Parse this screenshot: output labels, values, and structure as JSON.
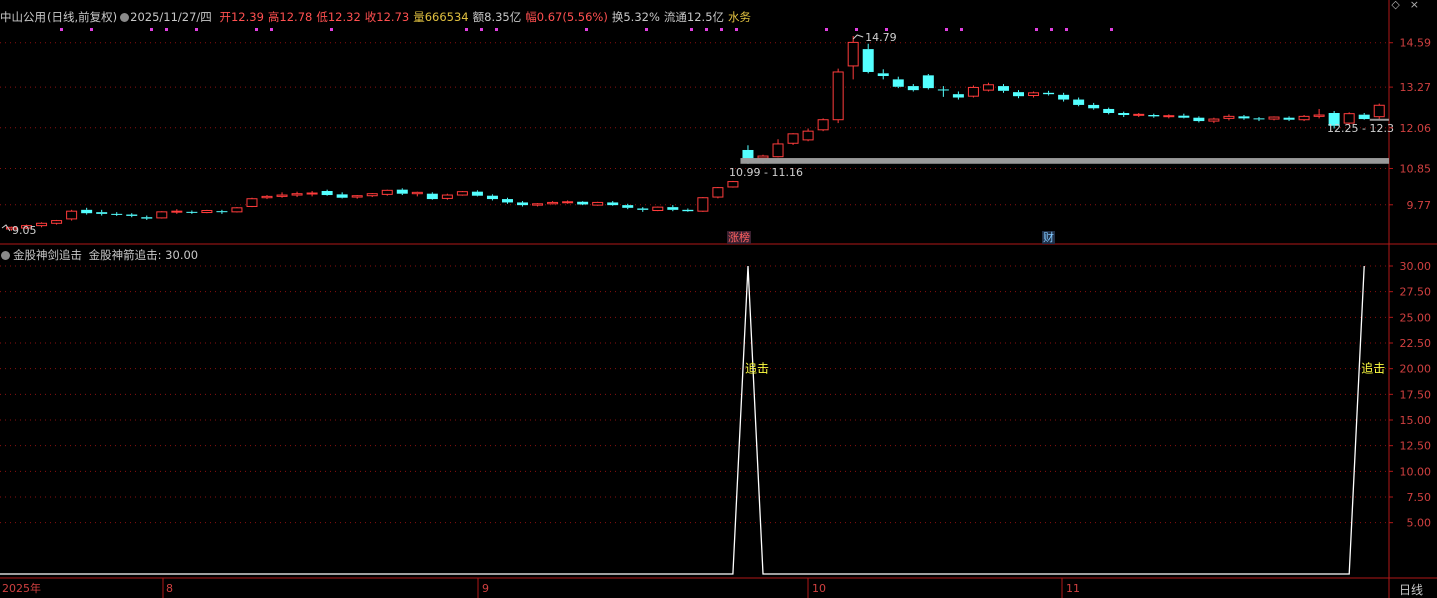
{
  "header": {
    "stock_name": "中山公用",
    "period_label": "(日线,前复权)",
    "date": "2025/11/27/四",
    "fields": [
      {
        "label": "开",
        "value": "12.39",
        "color": "#ff5050"
      },
      {
        "label": "高",
        "value": "12.78",
        "color": "#ff5050"
      },
      {
        "label": "低",
        "value": "12.32",
        "color": "#ff5050"
      },
      {
        "label": "收",
        "value": "12.73",
        "color": "#ff5050"
      },
      {
        "label": "量",
        "value": "666534",
        "color": "#e0c040"
      },
      {
        "label": "额",
        "value": "8.35亿",
        "color": "#c8c8c8"
      },
      {
        "label": "幅",
        "value": "0.67(5.56%)",
        "color": "#ff5050"
      },
      {
        "label": "换",
        "value": "5.32%",
        "color": "#c8c8c8"
      },
      {
        "label": "流通",
        "value": "12.5亿",
        "color": "#c8c8c8"
      },
      {
        "label": "",
        "value": "水务",
        "color": "#e0c040"
      }
    ]
  },
  "price_axis": {
    "labels": [
      "14.59",
      "13.27",
      "12.06",
      "10.85",
      "9.77"
    ]
  },
  "indicator_axis": {
    "labels": [
      "30.00",
      "27.50",
      "25.00",
      "22.50",
      "20.00",
      "17.50",
      "15.00",
      "12.50",
      "10.00",
      "7.50",
      "5.00"
    ]
  },
  "chart_annotations": {
    "high_label": "14.79",
    "low_label": "9.05",
    "support_band_label": "10.99 - 11.16",
    "current_band_label": "12.25 - 12.3"
  },
  "badges": [
    {
      "text": "涨榜",
      "color": "#ff6060",
      "bg": "#3a2030"
    },
    {
      "text": "财",
      "color": "#80c8ff",
      "bg": "#203048"
    }
  ],
  "indicator": {
    "name": "金股神剑追击",
    "value_label": "金股神箭追击: 30.00",
    "signal_text": "追击",
    "signal_color": "#ffff40"
  },
  "timeline": {
    "labels": [
      "2025年",
      "8",
      "9",
      "10",
      "11"
    ],
    "timeframe": "日线"
  },
  "chart_data": [
    {
      "type": "candlestick",
      "title": "中山公用(日线,前复权)",
      "ylim": [
        9.05,
        14.79
      ],
      "bars": [
        [
          9.05,
          9.12,
          9.0,
          9.1
        ],
        [
          9.08,
          9.18,
          9.05,
          9.15
        ],
        [
          9.15,
          9.25,
          9.1,
          9.22
        ],
        [
          9.22,
          9.32,
          9.18,
          9.3
        ],
        [
          9.35,
          9.62,
          9.3,
          9.58
        ],
        [
          9.62,
          9.68,
          9.48,
          9.52
        ],
        [
          9.55,
          9.62,
          9.45,
          9.5
        ],
        [
          9.5,
          9.55,
          9.44,
          9.48
        ],
        [
          9.48,
          9.52,
          9.4,
          9.44
        ],
        [
          9.4,
          9.45,
          9.32,
          9.36
        ],
        [
          9.38,
          9.58,
          9.36,
          9.56
        ],
        [
          9.56,
          9.64,
          9.5,
          9.58
        ],
        [
          9.56,
          9.6,
          9.5,
          9.54
        ],
        [
          9.54,
          9.62,
          9.52,
          9.6
        ],
        [
          9.58,
          9.62,
          9.5,
          9.56
        ],
        [
          9.56,
          9.7,
          9.54,
          9.68
        ],
        [
          9.72,
          9.98,
          9.7,
          9.95
        ],
        [
          9.98,
          10.06,
          9.94,
          10.02
        ],
        [
          10.02,
          10.14,
          9.98,
          10.06
        ],
        [
          10.06,
          10.16,
          10.0,
          10.1
        ],
        [
          10.1,
          10.18,
          10.02,
          10.12
        ],
        [
          10.18,
          10.22,
          10.04,
          10.06
        ],
        [
          10.08,
          10.14,
          9.96,
          9.98
        ],
        [
          10.0,
          10.06,
          9.95,
          10.04
        ],
        [
          10.04,
          10.12,
          10.0,
          10.1
        ],
        [
          10.08,
          10.22,
          10.04,
          10.2
        ],
        [
          10.22,
          10.26,
          10.06,
          10.1
        ],
        [
          10.1,
          10.16,
          10.02,
          10.14
        ],
        [
          10.1,
          10.14,
          9.92,
          9.94
        ],
        [
          9.96,
          10.1,
          9.92,
          10.06
        ],
        [
          10.06,
          10.18,
          10.04,
          10.16
        ],
        [
          10.16,
          10.2,
          10.02,
          10.04
        ],
        [
          10.04,
          10.08,
          9.9,
          9.94
        ],
        [
          9.94,
          9.98,
          9.8,
          9.84
        ],
        [
          9.84,
          9.88,
          9.72,
          9.76
        ],
        [
          9.76,
          9.82,
          9.72,
          9.8
        ],
        [
          9.8,
          9.88,
          9.78,
          9.84
        ],
        [
          9.84,
          9.9,
          9.8,
          9.86
        ],
        [
          9.86,
          9.88,
          9.76,
          9.78
        ],
        [
          9.76,
          9.86,
          9.74,
          9.84
        ],
        [
          9.84,
          9.88,
          9.74,
          9.76
        ],
        [
          9.76,
          9.8,
          9.64,
          9.68
        ],
        [
          9.66,
          9.7,
          9.56,
          9.62
        ],
        [
          9.6,
          9.72,
          9.58,
          9.7
        ],
        [
          9.7,
          9.76,
          9.58,
          9.62
        ],
        [
          9.62,
          9.66,
          9.56,
          9.58
        ],
        [
          9.58,
          10.0,
          9.56,
          9.98
        ],
        [
          10.0,
          10.3,
          9.96,
          10.28
        ],
        [
          10.3,
          10.48,
          10.28,
          10.46
        ],
        [
          11.4,
          11.54,
          10.99,
          11.0
        ],
        [
          11.16,
          11.26,
          10.99,
          11.22
        ],
        [
          11.2,
          11.72,
          11.18,
          11.58
        ],
        [
          11.6,
          11.9,
          11.55,
          11.88
        ],
        [
          11.7,
          12.04,
          11.66,
          11.96
        ],
        [
          12.0,
          12.34,
          11.96,
          12.3
        ],
        [
          12.3,
          13.82,
          12.2,
          13.72
        ],
        [
          13.9,
          14.79,
          13.5,
          14.6
        ],
        [
          14.4,
          14.56,
          13.68,
          13.72
        ],
        [
          13.68,
          13.8,
          13.5,
          13.6
        ],
        [
          13.5,
          13.58,
          13.24,
          13.28
        ],
        [
          13.3,
          13.36,
          13.14,
          13.18
        ],
        [
          13.62,
          13.66,
          13.2,
          13.24
        ],
        [
          13.2,
          13.3,
          12.98,
          13.18
        ],
        [
          13.06,
          13.14,
          12.9,
          12.96
        ],
        [
          13.0,
          13.32,
          12.96,
          13.26
        ],
        [
          13.18,
          13.4,
          13.14,
          13.34
        ],
        [
          13.3,
          13.36,
          13.1,
          13.16
        ],
        [
          13.12,
          13.18,
          12.94,
          13.0
        ],
        [
          13.02,
          13.14,
          12.96,
          13.1
        ],
        [
          13.1,
          13.16,
          13.02,
          13.06
        ],
        [
          13.04,
          13.1,
          12.84,
          12.9
        ],
        [
          12.9,
          12.96,
          12.7,
          12.74
        ],
        [
          12.74,
          12.8,
          12.6,
          12.64
        ],
        [
          12.62,
          12.66,
          12.46,
          12.5
        ],
        [
          12.5,
          12.54,
          12.38,
          12.44
        ],
        [
          12.44,
          12.5,
          12.38,
          12.46
        ],
        [
          12.44,
          12.48,
          12.36,
          12.4
        ],
        [
          12.4,
          12.46,
          12.34,
          12.42
        ],
        [
          12.42,
          12.48,
          12.34,
          12.36
        ],
        [
          12.36,
          12.4,
          12.22,
          12.26
        ],
        [
          12.26,
          12.36,
          12.2,
          12.32
        ],
        [
          12.34,
          12.46,
          12.28,
          12.4
        ],
        [
          12.4,
          12.44,
          12.3,
          12.34
        ],
        [
          12.34,
          12.38,
          12.26,
          12.32
        ],
        [
          12.32,
          12.4,
          12.28,
          12.38
        ],
        [
          12.36,
          12.4,
          12.26,
          12.3
        ],
        [
          12.3,
          12.44,
          12.26,
          12.4
        ],
        [
          12.4,
          12.62,
          12.34,
          12.44
        ],
        [
          12.5,
          12.56,
          12.04,
          12.12
        ],
        [
          12.2,
          12.52,
          12.14,
          12.48
        ],
        [
          12.45,
          12.5,
          12.3,
          12.32
        ],
        [
          12.39,
          12.78,
          12.32,
          12.73
        ]
      ],
      "support_band": [
        10.99,
        11.16
      ],
      "current_band": [
        12.25,
        12.3
      ]
    },
    {
      "type": "line",
      "title": "金股神剑追击",
      "ylim": [
        0,
        30
      ],
      "series": [
        {
          "name": "金股神箭追击",
          "values": [
            0,
            0,
            0,
            0,
            0,
            0,
            0,
            0,
            0,
            0,
            0,
            0,
            0,
            0,
            0,
            0,
            0,
            0,
            0,
            0,
            0,
            0,
            0,
            0,
            0,
            0,
            0,
            0,
            0,
            0,
            0,
            0,
            0,
            0,
            0,
            0,
            0,
            0,
            0,
            0,
            0,
            0,
            0,
            0,
            0,
            0,
            0,
            0,
            0,
            30,
            0,
            0,
            0,
            0,
            0,
            0,
            0,
            0,
            0,
            0,
            0,
            0,
            0,
            0,
            0,
            0,
            0,
            0,
            0,
            0,
            0,
            0,
            0,
            0,
            0,
            0,
            0,
            0,
            0,
            0,
            0,
            0,
            0,
            0,
            0,
            0,
            0,
            0,
            0,
            0,
            30
          ]
        }
      ]
    }
  ],
  "colors": {
    "bg": "#000000",
    "up": "#ff3c3c",
    "down": "#54ffff",
    "grid": "#8b1010",
    "border": "#b01818",
    "axis_text": "#d04040",
    "line": "#ffffff",
    "band": "#9a9a9a",
    "magenta_dots": "#e040e0"
  }
}
